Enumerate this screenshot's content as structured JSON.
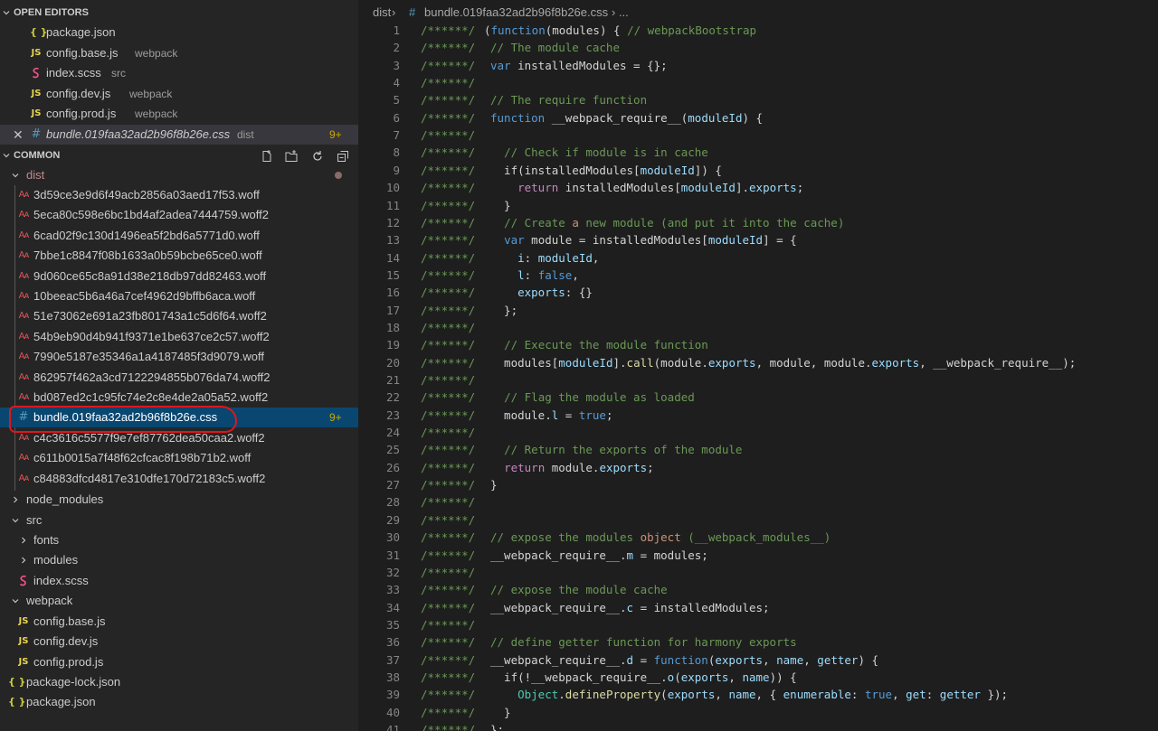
{
  "explorer": {
    "open_editors_title": "OPEN EDITORS",
    "open_editors": [
      {
        "name": "package.json",
        "icon": "json",
        "desc": ""
      },
      {
        "name": "config.base.js",
        "icon": "js",
        "desc": "webpack"
      },
      {
        "name": "index.scss",
        "icon": "scss",
        "desc": "src"
      },
      {
        "name": "config.dev.js",
        "icon": "js",
        "desc": "webpack"
      },
      {
        "name": "config.prod.js",
        "icon": "js",
        "desc": "webpack"
      },
      {
        "name": "bundle.019faa32ad2b96f8b26e.css",
        "icon": "css",
        "desc": "dist",
        "badge": "9+"
      }
    ],
    "folder_title": "COMMON",
    "dist_folder": "dist",
    "dist_files": [
      "3d59ce3e9d6f49acb2856a03aed17f53.woff",
      "5eca80c598e6bc1bd4af2adea7444759.woff2",
      "6cad02f9c130d1496ea5f2bd6a5771d0.woff",
      "7bbe1c8847f08b1633a0b59bcbe65ce0.woff",
      "9d060ce65c8a91d38e218db97dd82463.woff",
      "10beeac5b6a46a7cef4962d9bffb6aca.woff",
      "51e73062e691a23fb801743a1c5d6f64.woff2",
      "54b9eb90d4b941f9371e1be637ce2c57.woff2",
      "7990e5187e35346a1a4187485f3d9079.woff",
      "862957f462a3cd7122294855b076da74.woff2",
      "bd087ed2c1c95fc74e2c8e4de2a05a52.woff2",
      "bundle.019faa32ad2b96f8b26e.css",
      "c4c3616c5577f9e7ef87762dea50caa2.woff2",
      "c611b0015a7f48f62cfcac8f198b71b2.woff",
      "c84883dfcd4817e310dfe170d72183c5.woff2"
    ],
    "selected_badge": "9+",
    "node_modules": "node_modules",
    "src": "src",
    "fonts": "fonts",
    "modules": "modules",
    "index_scss": "index.scss",
    "webpack": "webpack",
    "webpack_files": [
      "config.base.js",
      "config.dev.js",
      "config.prod.js"
    ],
    "package_lock": "package-lock.json",
    "package_json": "package.json",
    "icon_glyphs": {
      "json": "{ }",
      "js": "JS",
      "css": "#",
      "woff": "Aᴀ"
    },
    "modified_dot_color": "#8a6a6a",
    "selection_color": "#094771",
    "highlight_circle_color": "#e0161b"
  },
  "breadcrumb": {
    "folder": "dist",
    "sep": "›",
    "hash": "#",
    "file": "bundle.019faa32ad2b96f8b26e.css",
    "tail": "› ..."
  },
  "editor": {
    "gutter_prefix": "/******/",
    "lines": [
      "(function(modules) { // webpackBootstrap",
      "// The module cache",
      "var installedModules = {};",
      "",
      "// The require function",
      "function __webpack_require__(moduleId) {",
      "",
      "  // Check if module is in cache",
      "  if(installedModules[moduleId]) {",
      "    return installedModules[moduleId].exports;",
      "  }",
      "  // Create a new module (and put it into the cache)",
      "  var module = installedModules[moduleId] = {",
      "    i: moduleId,",
      "    l: false,",
      "    exports: {}",
      "  };",
      "",
      "  // Execute the module function",
      "  modules[moduleId].call(module.exports, module, module.exports, __webpack_require__);",
      "",
      "  // Flag the module as loaded",
      "  module.l = true;",
      "",
      "  // Return the exports of the module",
      "  return module.exports;",
      "}",
      "",
      "",
      "// expose the modules object (__webpack_modules__)",
      "__webpack_require__.m = modules;",
      "",
      "// expose the module cache",
      "__webpack_require__.c = installedModules;",
      "",
      "// define getter function for harmony exports",
      "__webpack_require__.d = function(exports, name, getter) {",
      "  if(!__webpack_require__.o(exports, name)) {",
      "    Object.defineProperty(exports, name, { enumerable: true, get: getter });",
      "  }",
      "};"
    ]
  }
}
